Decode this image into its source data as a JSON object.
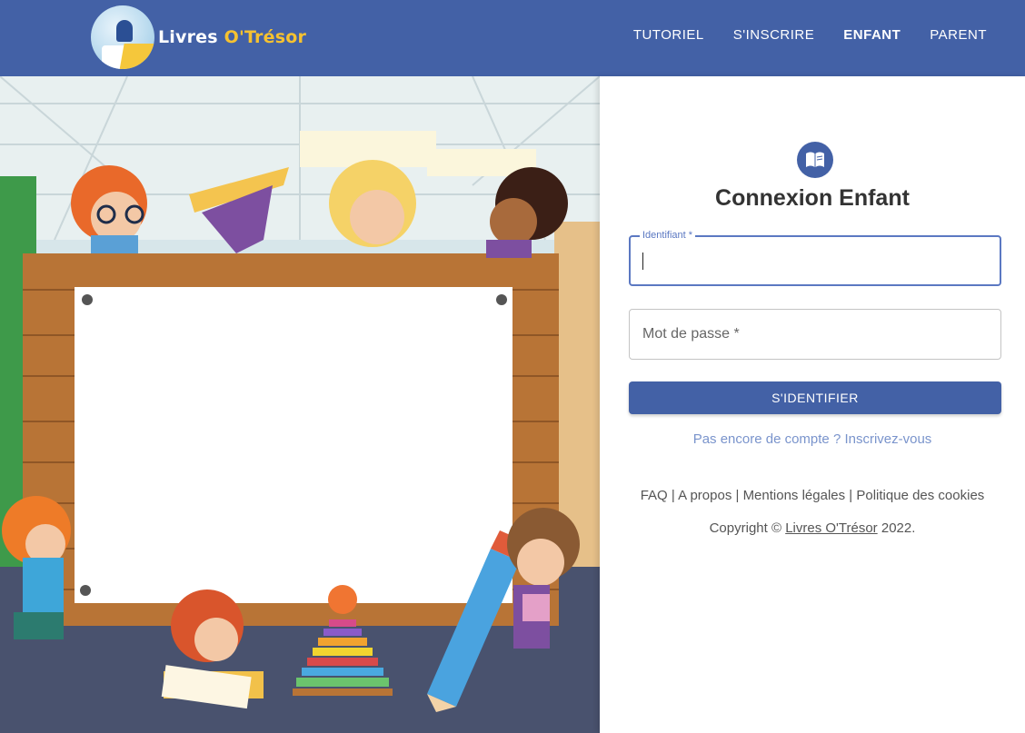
{
  "header": {
    "logo_text_1": "Livres",
    "logo_text_2": "O'Trésor",
    "nav": [
      {
        "label": "TUTORIEL"
      },
      {
        "label": "S'INSCRIRE"
      },
      {
        "label": "ENFANT",
        "active": true
      },
      {
        "label": "PARENT"
      }
    ]
  },
  "login": {
    "icon": "open-book-icon",
    "title": "Connexion Enfant",
    "username_label": "Identifiant *",
    "username_value": "",
    "password_placeholder": "Mot de passe *",
    "submit_label": "S'IDENTIFIER",
    "signup_link": "Pas encore de compte ? Inscrivez-vous"
  },
  "footer": {
    "links": [
      "FAQ",
      "A propos",
      "Mentions légales",
      "Politique des cookies"
    ],
    "separator": " | ",
    "copyright_prefix": "Copyright © ",
    "copyright_brand": "Livres O'Trésor",
    "copyright_suffix": " 2022."
  },
  "colors": {
    "primary": "#4361a6",
    "link": "#7a94cc",
    "accent_yellow": "#f6c230"
  }
}
